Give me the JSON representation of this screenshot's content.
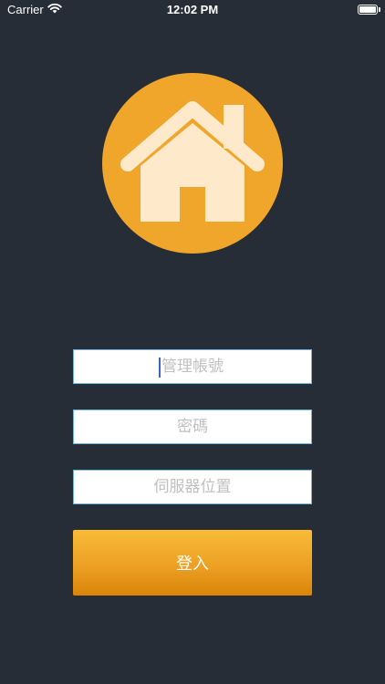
{
  "status_bar": {
    "carrier": "Carrier",
    "time": "12:02 PM",
    "icons": [
      "wifi-icon",
      "battery-icon"
    ]
  },
  "logo": {
    "icon": "house-icon",
    "circle_color": "#f0a62a",
    "house_color": "#feeacb"
  },
  "form": {
    "account_placeholder": "管理帳號",
    "password_placeholder": "密碼",
    "server_placeholder": "伺服器位置",
    "account_value": "",
    "password_value": "",
    "server_value": ""
  },
  "login_button": {
    "label": "登入",
    "color": "#f0a62a"
  },
  "colors": {
    "background": "#272d37",
    "input_border": "#6fb7dc",
    "caret": "#3a66c9"
  }
}
